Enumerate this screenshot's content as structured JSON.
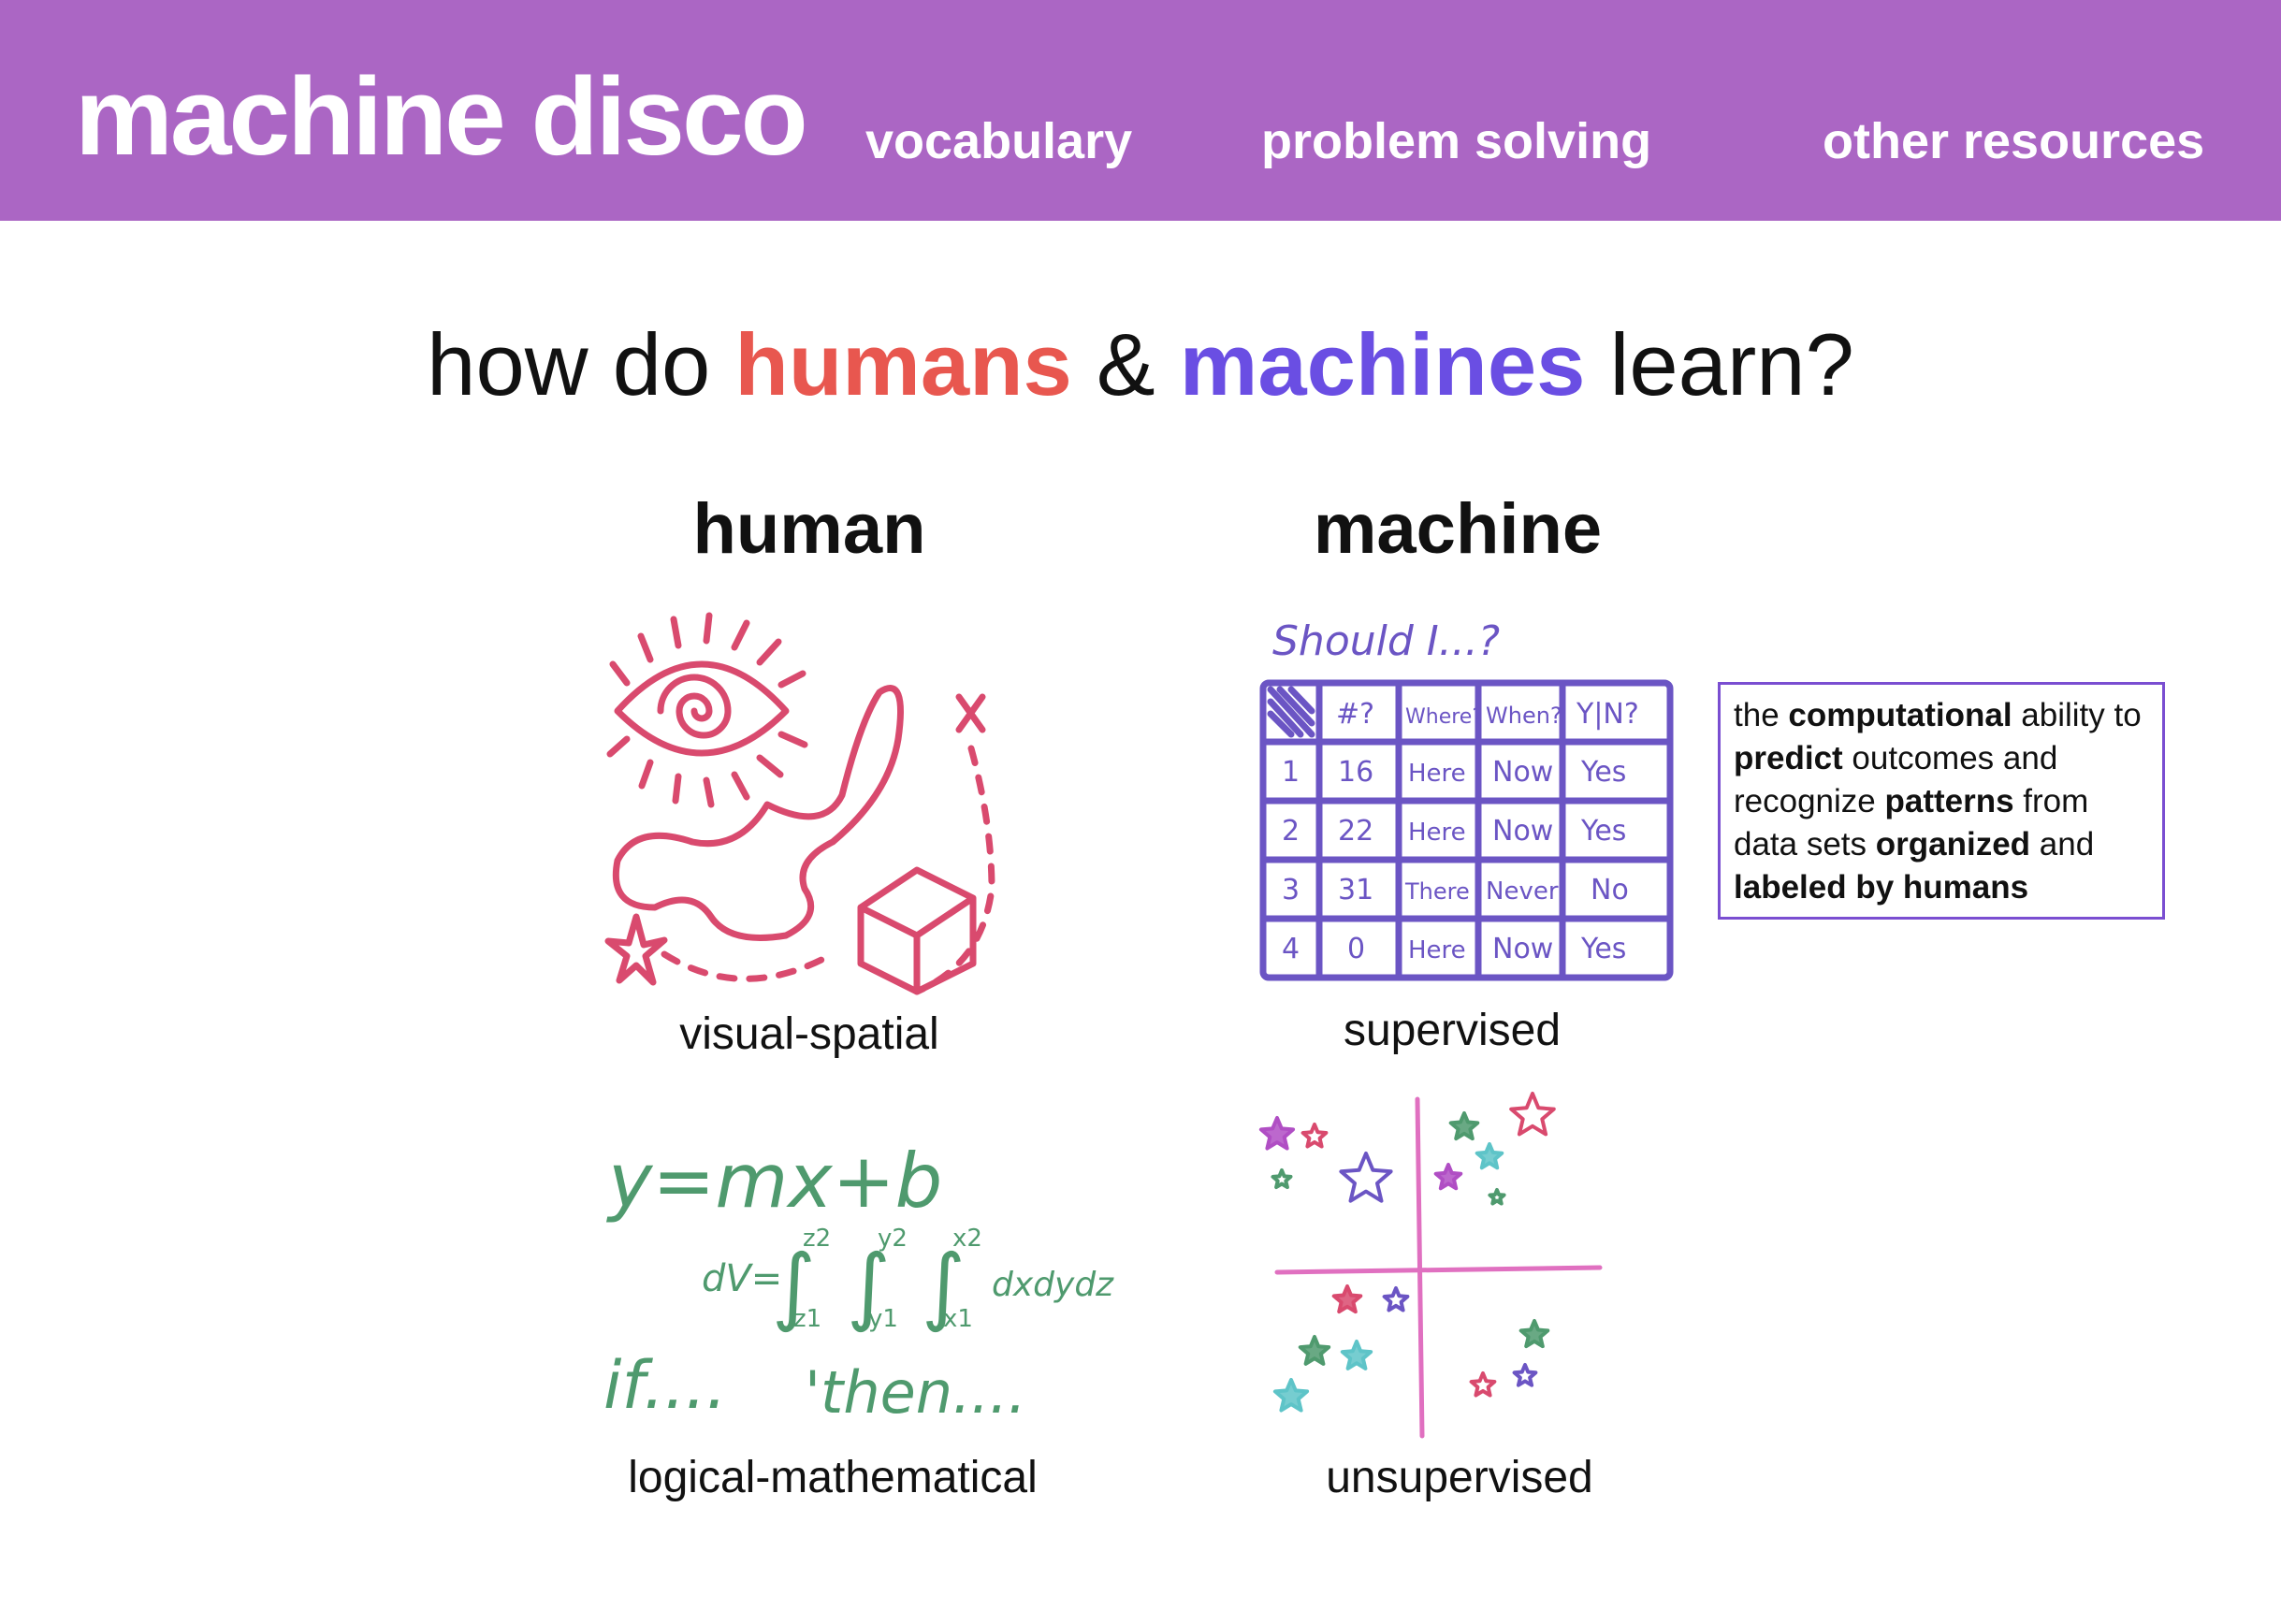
{
  "header": {
    "brand": "machine disco",
    "nav": [
      "vocabulary",
      "problem solving",
      "other resources"
    ]
  },
  "question": {
    "prefix": "how do ",
    "humans": "humans",
    "amp": " & ",
    "machines": "machines",
    "suffix": " learn?"
  },
  "columns": {
    "human": "human",
    "machine": "machine"
  },
  "captions": {
    "visual_spatial": "visual-spatial",
    "supervised": "supervised",
    "logical_mathematical": "logical-mathematical",
    "unsupervised": "unsupervised"
  },
  "supervised_box": {
    "t1": "the ",
    "b1": "computational",
    "t2": " ability to ",
    "b2": "predict",
    "t3": " outcomes and recognize ",
    "b3": "patterns",
    "t4": " from data sets ",
    "b4": "organized",
    "t5": " and ",
    "b5": "labeled by humans"
  },
  "handwritten_table": {
    "title": "Should I...?",
    "headers": [
      "#?",
      "Where?",
      "When?",
      "Y|N?"
    ],
    "rows": [
      [
        "1",
        "16",
        "Here",
        "Now",
        "Yes"
      ],
      [
        "2",
        "22",
        "Here",
        "Now",
        "Yes"
      ],
      [
        "3",
        "31",
        "There",
        "Never",
        "No"
      ],
      [
        "4",
        "0",
        "Here",
        "Now",
        "Yes"
      ]
    ]
  },
  "handwritten_math": {
    "line1": "y=mx+b",
    "dv": "dV=",
    "integrand": "dxdydz",
    "limits": [
      "z2",
      "z1",
      "y2",
      "y1",
      "x2",
      "x1"
    ],
    "line3a": "if....",
    "line3b": "'then...."
  },
  "colors": {
    "header_bg": "#ab66c4",
    "humans": "#e8574f",
    "machines": "#6a4ee3",
    "visual_drawing": "#d94a6e",
    "table_drawing": "#6b55c4",
    "math_drawing": "#4f9a6e",
    "box_border": "#7a4ed1",
    "axis": "#e070c0"
  }
}
